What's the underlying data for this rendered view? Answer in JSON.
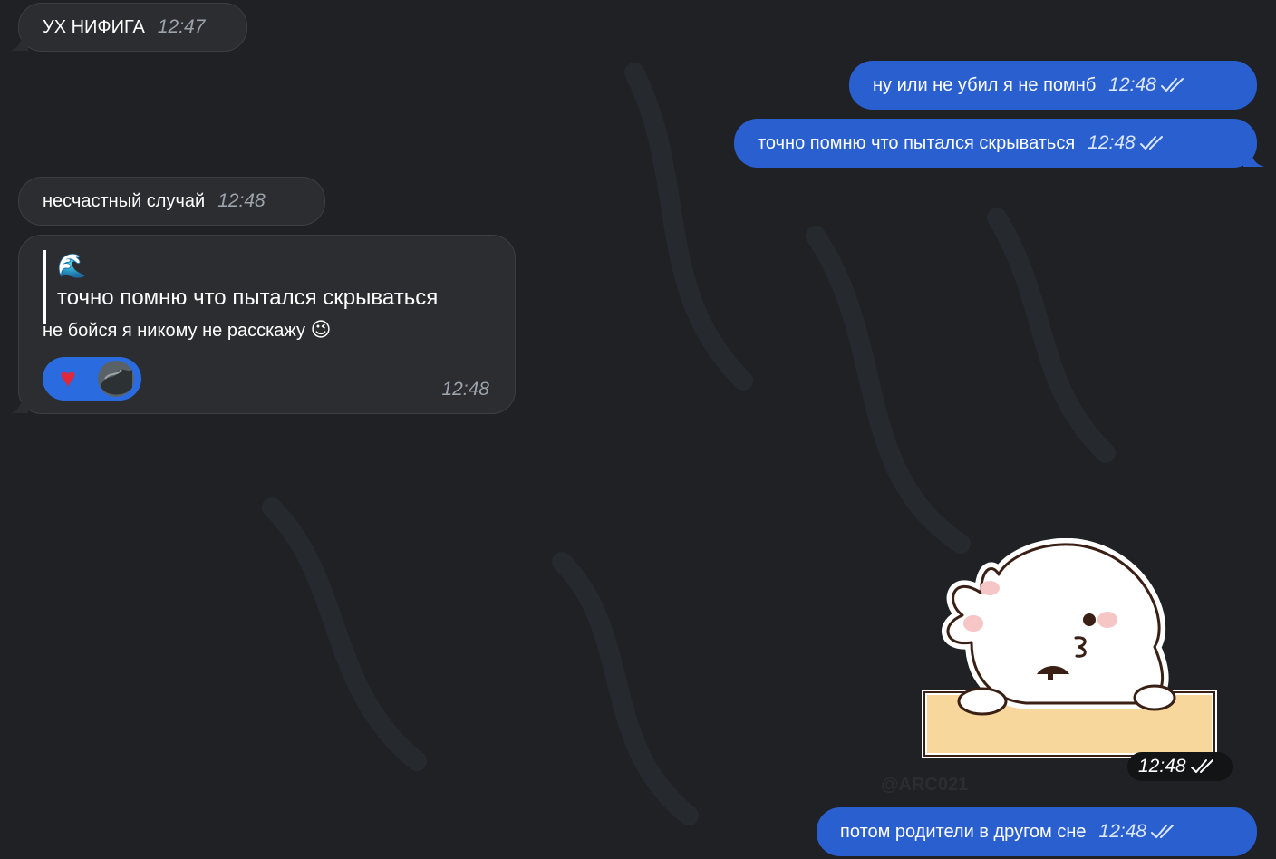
{
  "messages": [
    {
      "text": "УХ НИФИГА",
      "time": "12:47"
    },
    {
      "text": "ну или не убил я не помнб",
      "time": "12:48"
    },
    {
      "text": "точно помню что пытался скрываться",
      "time": "12:48"
    },
    {
      "text": "несчастный случай",
      "time": "12:48"
    },
    {
      "reply_sender_emoji": "🌊",
      "reply_text": "точно помню что пытался скрываться",
      "text": "не бойся я никому не расскажу",
      "emoji": "😉",
      "reaction": "♥",
      "time": "12:48"
    },
    {
      "sticker_time": "12:48",
      "watermark": "@ARC021"
    },
    {
      "text": "потом родители в другом сне",
      "time": "12:48"
    }
  ],
  "colors": {
    "background": "#1f2124",
    "incoming_bubble": "#2c2d30",
    "outgoing_bubble": "#2a5fd0",
    "reaction_heart": "#e0283a"
  },
  "icons": [
    "double-check-icon",
    "heart-icon",
    "avatar"
  ]
}
